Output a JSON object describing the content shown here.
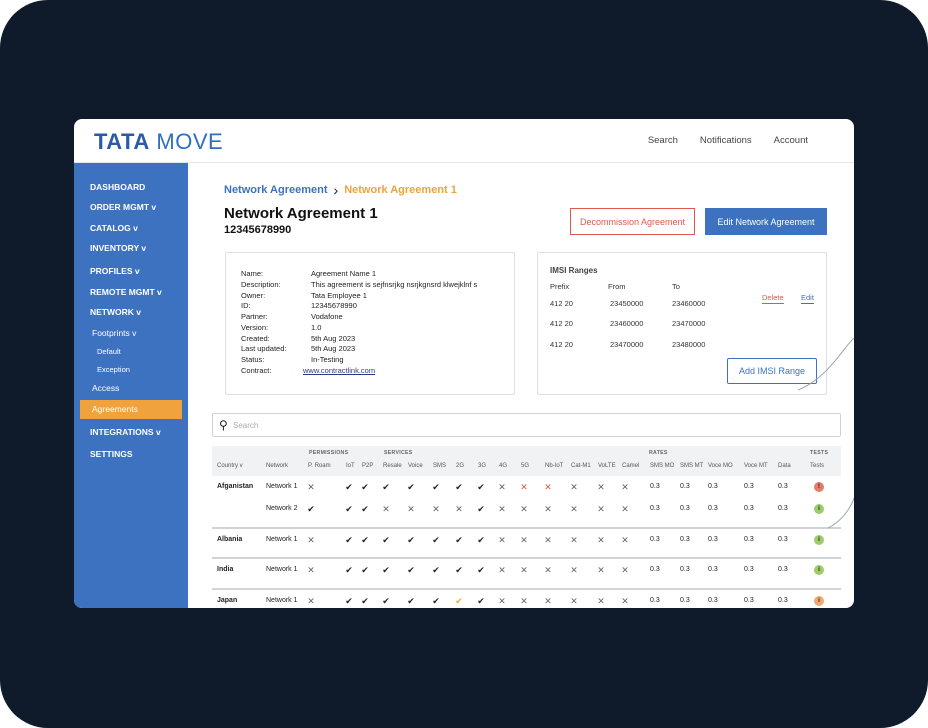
{
  "brand": {
    "bold": "TATA",
    "light": "MOVE",
    "accent": "#3d72c0",
    "highlight": "#f0a33c"
  },
  "topnav": [
    "Search",
    "Notifications",
    "Account"
  ],
  "sidebar": [
    {
      "label": "DASHBOARD"
    },
    {
      "label": "ORDER MGMT v"
    },
    {
      "label": "CATALOG v"
    },
    {
      "label": "INVENTORY v"
    },
    {
      "label": "PROFILES v"
    },
    {
      "label": "REMOTE MGMT v"
    },
    {
      "label": "NETWORK v"
    },
    {
      "label": "Footprints v"
    },
    {
      "label": "Default"
    },
    {
      "label": "Exception"
    },
    {
      "label": "Access"
    },
    {
      "label": "Agreements"
    },
    {
      "label": "INTEGRATIONS v"
    },
    {
      "label": "SETTINGS"
    }
  ],
  "breadcrumb": {
    "parent": "Network Agreement",
    "current": "Network Agreement 1"
  },
  "page": {
    "title": "Network Agreement 1",
    "id": "12345678990"
  },
  "buttons": {
    "decommission": "Decommission Agreement",
    "edit": "Edit Network Agreement",
    "add_imsi": "Add IMSI Range"
  },
  "info": [
    {
      "k": "Name:",
      "v": "Agreement Name 1"
    },
    {
      "k": "Description:",
      "v": "This agreement is sejfnsrjkg nsrjkgnsrd klwejklnf s"
    },
    {
      "k": "Owner:",
      "v": "Tata Employee 1"
    },
    {
      "k": "ID:",
      "v": "12345678990"
    },
    {
      "k": "Partner:",
      "v": "Vodafone"
    },
    {
      "k": "Version:",
      "v": "1.0"
    },
    {
      "k": "Created:",
      "v": "5th Aug 2023"
    },
    {
      "k": "Last updated:",
      "v": "5th Aug 2023"
    },
    {
      "k": "Status:",
      "v": "In-Testing"
    },
    {
      "k": "Contract:",
      "v": "www.contractlink.com"
    }
  ],
  "imsi": {
    "title": "IMSI Ranges",
    "headers": [
      "Prefix",
      "From",
      "To"
    ],
    "rows": [
      [
        "412 20",
        "23450000",
        "23460000"
      ],
      [
        "412 20",
        "23460000",
        "23470000"
      ],
      [
        "412 20",
        "23470000",
        "23480000"
      ]
    ],
    "delete": "Delete",
    "edit": "Edit"
  },
  "search": {
    "placeholder": "Search"
  },
  "table": {
    "groups": [
      "PERMISSIONS",
      "SERVICES",
      "RATES",
      "TESTS"
    ],
    "headers": [
      "Country v",
      "Network",
      "P. Roam",
      "IoT",
      "P2P",
      "Resale",
      "Voice",
      "SMS",
      "2G",
      "3G",
      "4G",
      "5G",
      "Nb-IoT",
      "Cat-M1",
      "VoLTE",
      "Camel",
      "SMS MO",
      "SMS MT",
      "Voce MO",
      "Voce MT",
      "Data",
      "Tests"
    ],
    "rows": [
      {
        "country": "Afganistan",
        "network": "Network 1",
        "marks": [
          "x",
          "v",
          "v",
          "v",
          "v",
          "v",
          "v",
          "v",
          "x",
          "xr",
          "xr",
          "x",
          "x",
          "x"
        ],
        "rates": [
          "0.3",
          "0.3",
          "0.3",
          "0.3",
          "0.3"
        ],
        "test": {
          "symbol": "!",
          "status": "fail"
        }
      },
      {
        "country": "",
        "network": "Network 2",
        "marks": [
          "v",
          "v",
          "v",
          "x",
          "x",
          "x",
          "x",
          "v",
          "x",
          "x",
          "x",
          "x",
          "x",
          "x"
        ],
        "rates": [
          "0.3",
          "0.3",
          "0.3",
          "0.3",
          "0.3"
        ],
        "test": {
          "symbol": "i",
          "status": "pass"
        }
      },
      {
        "country": "Albania",
        "network": "Network 1",
        "marks": [
          "x",
          "v",
          "v",
          "v",
          "v",
          "v",
          "v",
          "v",
          "x",
          "x",
          "x",
          "x",
          "x",
          "x"
        ],
        "rates": [
          "0.3",
          "0.3",
          "0.3",
          "0.3",
          "0.3"
        ],
        "test": {
          "symbol": "i",
          "status": "pass"
        }
      },
      {
        "country": "India",
        "network": "Network 1",
        "marks": [
          "x",
          "v",
          "v",
          "v",
          "v",
          "v",
          "v",
          "v",
          "x",
          "x",
          "x",
          "x",
          "x",
          "x"
        ],
        "rates": [
          "0.3",
          "0.3",
          "0.3",
          "0.3",
          "0.3"
        ],
        "test": {
          "symbol": "i",
          "status": "pass"
        }
      },
      {
        "country": "Japan",
        "network": "Network 1",
        "marks": [
          "x",
          "v",
          "v",
          "v",
          "v",
          "v",
          "co",
          "v",
          "x",
          "x",
          "x",
          "x",
          "x",
          "x"
        ],
        "rates": [
          "0.3",
          "0.3",
          "0.3",
          "0.3",
          "0.3"
        ],
        "test": {
          "symbol": "i",
          "status": "warn"
        }
      }
    ]
  }
}
